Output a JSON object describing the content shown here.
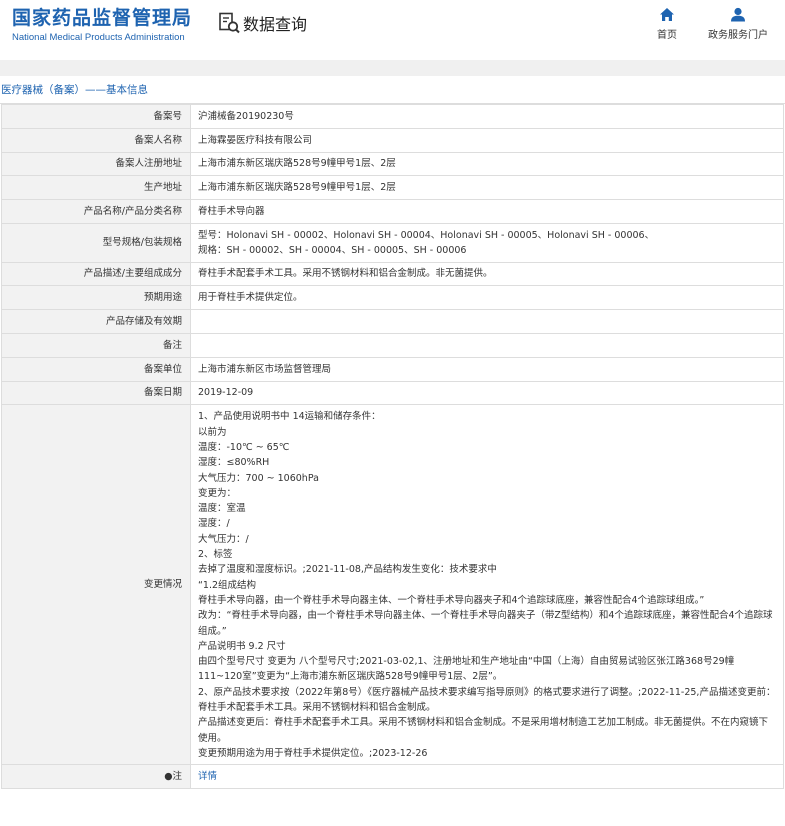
{
  "header": {
    "logo_cn": "国家药品监督管理局",
    "logo_en": "National Medical Products Administration",
    "query_label": "数据查询",
    "nav": [
      {
        "label": "首页",
        "icon": "home-icon"
      },
      {
        "label": "政务服务门户",
        "icon": "user-icon"
      }
    ],
    "accent_color": "#1e63b0"
  },
  "breadcrumb": "医疗器械（备案）——基本信息",
  "rows": [
    {
      "key": "备案号",
      "value": "沪浦械备20190230号"
    },
    {
      "key": "备案人名称",
      "value": "上海霖晏医疗科技有限公司"
    },
    {
      "key": "备案人注册地址",
      "value": "上海市浦东新区瑞庆路528号9幢甲号1层、2层"
    },
    {
      "key": "生产地址",
      "value": "上海市浦东新区瑞庆路528号9幢甲号1层、2层"
    },
    {
      "key": "产品名称/产品分类名称",
      "value": "脊柱手术导向器"
    },
    {
      "key": "型号规格/包装规格",
      "value": "型号：Holonavi SH - 00002、Holonavi SH - 00004、Holonavi SH - 00005、Holonavi SH - 00006、\n规格：SH - 00002、SH - 00004、SH - 00005、SH - 00006"
    },
    {
      "key": "产品描述/主要组成成分",
      "value": "脊柱手术配套手术工具。采用不锈钢材料和铝合金制成。非无菌提供。"
    },
    {
      "key": "预期用途",
      "value": "用于脊柱手术提供定位。"
    },
    {
      "key": "产品存储及有效期",
      "value": ""
    },
    {
      "key": "备注",
      "value": ""
    },
    {
      "key": "备案单位",
      "value": "上海市浦东新区市场监督管理局"
    },
    {
      "key": "备案日期",
      "value": "2019-12-09"
    },
    {
      "key": "变更情况",
      "value": "1、产品使用说明书中 14运输和储存条件：\n以前为\n温度：-10℃ ~ 65℃\n湿度：≤80%RH\n大气压力：700 ~ 1060hPa\n变更为：\n温度：室温\n湿度：/\n大气压力：/\n2、标签\n去掉了温度和湿度标识。;2021-11-08,产品结构发生变化：技术要求中\n“1.2组成结构\n脊柱手术导向器，由一个脊柱手术导向器主体、一个脊柱手术导向器夹子和4个追踪球底座，兼容性配合4个追踪球组成。”\n改为：“脊柱手术导向器，由一个脊柱手术导向器主体、一个脊柱手术导向器夹子（带Z型结构）和4个追踪球底座，兼容性配合4个追踪球组成。”\n产品说明书 9.2 尺寸\n由四个型号尺寸 变更为 八个型号尺寸;2021-03-02,1、注册地址和生产地址由“中国（上海）自由贸易试验区张江路368号29幢111~120室”变更为“上海市浦东新区瑞庆路528号9幢甲号1层、2层”。\n2、原产品技术要求按（2022年第8号）《医疗器械产品技术要求编写指导原则》的格式要求进行了调整。;2022-11-25,产品描述变更前：脊柱手术配套手术工具。采用不锈钢材料和铝合金制成。\n产品描述变更后：脊柱手术配套手术工具。采用不锈钢材料和铝合金制成。不是采用增材制造工艺加工制成。非无菌提供。不在内窥镜下使用。\n变更预期用途为用于脊柱手术提供定位。;2023-12-26"
    },
    {
      "key": "●注",
      "value": "详情"
    }
  ]
}
